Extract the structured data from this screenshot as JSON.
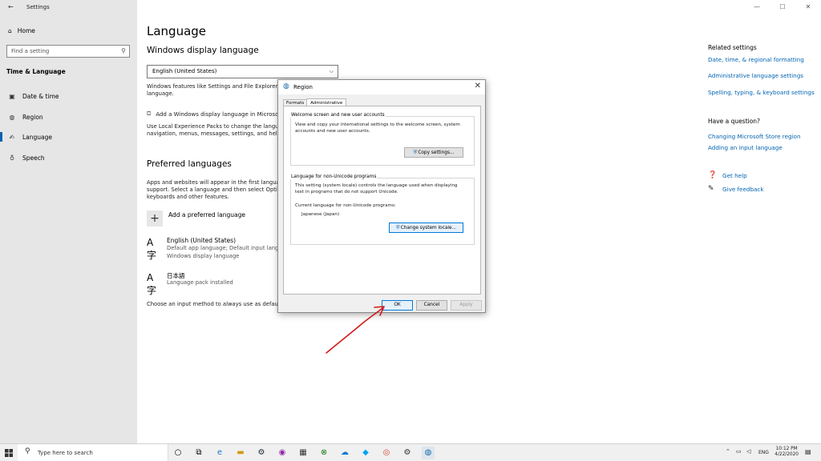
{
  "window": {
    "title": "Settings",
    "controls": [
      "—",
      "☐",
      "✕"
    ]
  },
  "sidebar": {
    "home": "Home",
    "search_placeholder": "Find a setting",
    "section": "Time & Language",
    "items": [
      {
        "label": "Date & time",
        "icon": "calendar-clock-icon"
      },
      {
        "label": "Region",
        "icon": "globe-icon"
      },
      {
        "label": "Language",
        "icon": "language-icon"
      },
      {
        "label": "Speech",
        "icon": "microphone-icon"
      }
    ]
  },
  "main": {
    "title": "Language",
    "display_heading": "Windows display language",
    "display_selected": "English (United States)",
    "display_desc_1": "Windows features like Settings and File Explorer w",
    "display_desc_2": "language.",
    "add_display_link": "Add a Windows display language in Microsof",
    "lxp_desc_1": "Use Local Experience Packs to change the languag",
    "lxp_desc_2": "navigation, menus, messages, settings, and help to",
    "preferred_heading": "Preferred languages",
    "preferred_desc_1": "Apps and websites will appear in the first languag",
    "preferred_desc_2": "support. Select a language and then select Option",
    "preferred_desc_3": "keyboards and other features.",
    "add_preferred": "Add a preferred language",
    "languages": [
      {
        "name": "English (United States)",
        "sub1": "Default app language; Default input langua",
        "sub2": "Windows display language"
      },
      {
        "name": "日本語",
        "sub1": "Language pack installed",
        "sub2": ""
      }
    ],
    "input_method_text": "Choose an input method to always use as default"
  },
  "related": {
    "heading": "Related settings",
    "links": [
      "Date, time, & regional formatting",
      "Administrative language settings",
      "Spelling, typing, & keyboard settings"
    ],
    "question_heading": "Have a question?",
    "question_links": [
      "Changing Microsoft Store region",
      "Adding an input language"
    ],
    "help": "Get help",
    "feedback": "Give feedback"
  },
  "dialog": {
    "title": "Region",
    "tabs": [
      "Formats",
      "Administrative"
    ],
    "welcome_group": "Welcome screen and new user accounts",
    "welcome_text_1": "View and copy your international settings to the welcome screen, system",
    "welcome_text_2": "accounts and new user accounts.",
    "copy_button": "Copy settings...",
    "unicode_group": "Language for non-Unicode programs",
    "unicode_text_1": "This setting (system locale) controls the language used when displaying",
    "unicode_text_2": "text in programs that do not support Unicode.",
    "current_label": "Current language for non-Unicode programs:",
    "current_value": "Japanese (Japan)",
    "change_button": "Change system locale...",
    "ok": "OK",
    "cancel": "Cancel",
    "apply": "Apply"
  },
  "taskbar": {
    "search_placeholder": "Type here to search",
    "lang": "ENG",
    "time": "10:12 PM",
    "date": "4/22/2020"
  },
  "colors": {
    "accent": "#0063b1",
    "arrow": "#d11a1a",
    "sidebar_bg": "#e6e6e6"
  }
}
